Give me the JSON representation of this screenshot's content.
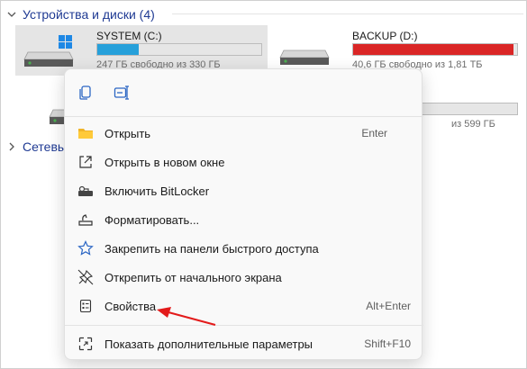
{
  "devices_header": {
    "label": "Устройства и диски (4)"
  },
  "network_header": {
    "label": "Сетевы"
  },
  "drives": [
    {
      "name": "SYSTEM (C:)",
      "free_text": "247 ГБ свободно из 330 ГБ",
      "used_fraction": 0.25,
      "bar_color": "#26a0da",
      "selected": true
    },
    {
      "name": "BACKUP (D:)",
      "free_text": "40,6 ГБ свободно из 1,81 ТБ",
      "used_fraction": 0.98,
      "bar_color": "#da2626",
      "selected": false
    },
    {
      "name": "",
      "free_text": "",
      "used_fraction": 0.0,
      "bar_color": "#26a0da",
      "selected": false
    },
    {
      "name": "",
      "free_text": "из 599 ГБ",
      "used_fraction": 0.35,
      "bar_color": "#26a0da",
      "selected": false
    }
  ],
  "context_menu": {
    "items": [
      {
        "label": "Открыть",
        "shortcut": "Enter",
        "icon": "folder-icon"
      },
      {
        "label": "Открыть в новом окне",
        "shortcut": "",
        "icon": "open-new-window-icon"
      },
      {
        "label": "Включить BitLocker",
        "shortcut": "",
        "icon": "bitlocker-key-icon"
      },
      {
        "label": "Форматировать...",
        "shortcut": "",
        "icon": "format-drive-icon"
      },
      {
        "label": "Закрепить на панели быстрого доступа",
        "shortcut": "",
        "icon": "star-icon"
      },
      {
        "label": "Открепить от начального экрана",
        "shortcut": "",
        "icon": "unpin-icon"
      },
      {
        "label": "Свойства",
        "shortcut": "Alt+Enter",
        "icon": "properties-icon"
      },
      {
        "label": "Показать дополнительные параметры",
        "shortcut": "Shift+F10",
        "icon": "more-options-icon"
      }
    ]
  },
  "colors": {
    "accent": "#26a0da",
    "warning": "#da2626",
    "arrow": "#e31b1b"
  }
}
